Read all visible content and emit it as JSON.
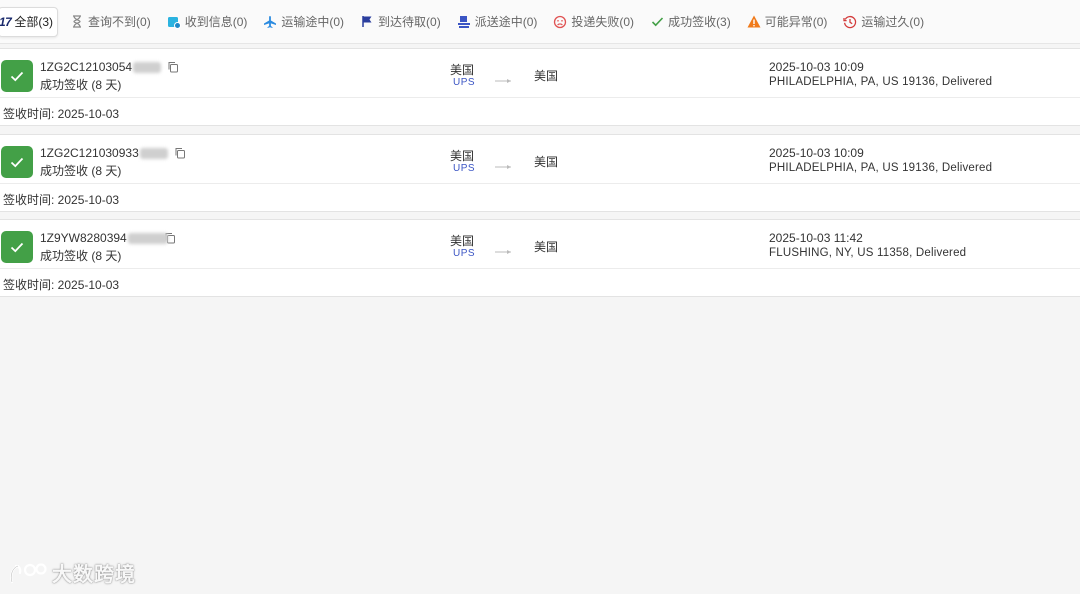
{
  "tabs": [
    {
      "id": "all",
      "logo": "17",
      "label": "全部(3)",
      "icon": "seventeen-track-logo",
      "active": true
    },
    {
      "id": "not-found",
      "label": "查询不到(0)",
      "icon": "hourglass-icon",
      "color": "#888888"
    },
    {
      "id": "info-received",
      "label": "收到信息(0)",
      "icon": "info-received-icon",
      "color": "#2bb3e0"
    },
    {
      "id": "in-transit",
      "label": "运输途中(0)",
      "icon": "airplane-icon",
      "color": "#2b8be0"
    },
    {
      "id": "pick-up",
      "label": "到达待取(0)",
      "icon": "flag-icon",
      "color": "#2b3e9e"
    },
    {
      "id": "out-for-delivery",
      "label": "派送途中(0)",
      "icon": "delivery-icon",
      "color": "#3b55c4"
    },
    {
      "id": "undelivered",
      "label": "投递失败(0)",
      "icon": "sad-face-icon",
      "color": "#e05252"
    },
    {
      "id": "delivered",
      "label": "成功签收(3)",
      "icon": "checkmark-icon",
      "color": "#43a047"
    },
    {
      "id": "alert",
      "label": "可能异常(0)",
      "icon": "warning-icon",
      "color": "#f07a1a"
    },
    {
      "id": "expired",
      "label": "运输过久(0)",
      "icon": "clock-history-icon",
      "color": "#d33b3b"
    }
  ],
  "shipments": [
    {
      "tracking_prefix": "1ZG2C12103054",
      "status": "成功签收 (8 天)",
      "origin": "美国",
      "carrier": "UPS",
      "destination": "美国",
      "event_time": "2025-10-03 10:09",
      "event_desc": "PHILADELPHIA, PA, US 19136, Delivered",
      "sign_time": "签收时间: 2025-10-03"
    },
    {
      "tracking_prefix": "1ZG2C121030933",
      "status": "成功签收 (8 天)",
      "origin": "美国",
      "carrier": "UPS",
      "destination": "美国",
      "event_time": "2025-10-03 10:09",
      "event_desc": "PHILADELPHIA, PA, US 19136, Delivered",
      "sign_time": "签收时间: 2025-10-03"
    },
    {
      "tracking_prefix": "1Z9YW8280394",
      "status": "成功签收 (8 天)",
      "origin": "美国",
      "carrier": "UPS",
      "destination": "美国",
      "event_time": "2025-10-03 11:42",
      "event_desc": "FLUSHING, NY, US 11358, Delivered",
      "sign_time": "签收时间: 2025-10-03"
    }
  ],
  "watermark": {
    "text": "大数跨境",
    "icon": "watermark-logo-icon"
  },
  "colors": {
    "delivered_green": "#43a047",
    "carrier_blue": "#3b55c4"
  }
}
